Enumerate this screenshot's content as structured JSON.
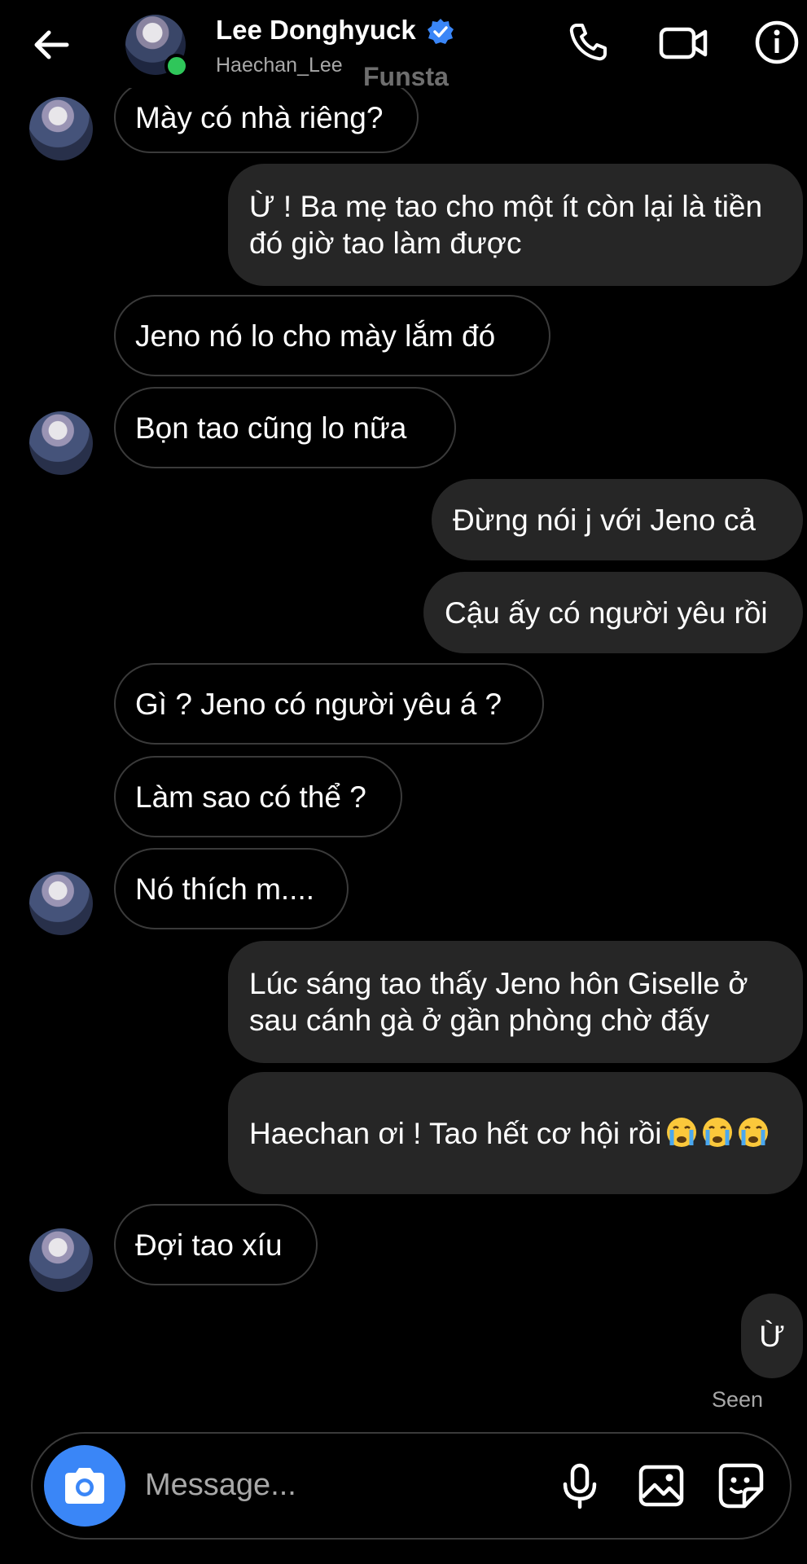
{
  "header": {
    "name": "Lee Donghyuck",
    "username": "Haechan_Lee",
    "overlay_text": "Funsta",
    "icons": [
      "back-arrow-icon",
      "verified-badge-icon",
      "phone-icon",
      "video-camera-icon",
      "info-icon"
    ]
  },
  "messages": [
    {
      "side": "in",
      "text": "Mày có nhà riêng?"
    },
    {
      "side": "out",
      "text": "Ừ ! Ba mẹ tao cho một ít còn lại là tiền đó giờ tao làm được"
    },
    {
      "side": "in",
      "text": "Jeno nó lo cho mày lắm đó"
    },
    {
      "side": "in",
      "text": "Bọn tao cũng lo nữa"
    },
    {
      "side": "out",
      "text": "Đừng nói j với Jeno cả"
    },
    {
      "side": "out",
      "text": "Cậu ấy có người yêu rồi"
    },
    {
      "side": "in",
      "text": "Gì ? Jeno có người yêu á ?"
    },
    {
      "side": "in",
      "text": "Làm sao có thể ?"
    },
    {
      "side": "in",
      "text": "Nó thích m...."
    },
    {
      "side": "out",
      "text": "Lúc sáng tao thấy Jeno hôn Giselle ở sau cánh gà ở gần phòng chờ đấy"
    },
    {
      "side": "out",
      "text": "Haechan ơi ! Tao hết cơ hội rồi",
      "emoji": "crying-face"
    },
    {
      "side": "in",
      "text": "Đợi tao xíu"
    },
    {
      "side": "out",
      "text": "Ừ"
    }
  ],
  "status": {
    "seen": "Seen"
  },
  "composer": {
    "placeholder": "Message...",
    "icons": [
      "camera-icon",
      "microphone-icon",
      "gallery-icon",
      "sticker-icon"
    ]
  },
  "colors": {
    "background": "#000000",
    "outgoing_bubble": "#262626",
    "incoming_border": "#3a3a3a",
    "accent": "#3a86f7",
    "online": "#2fc65a"
  }
}
